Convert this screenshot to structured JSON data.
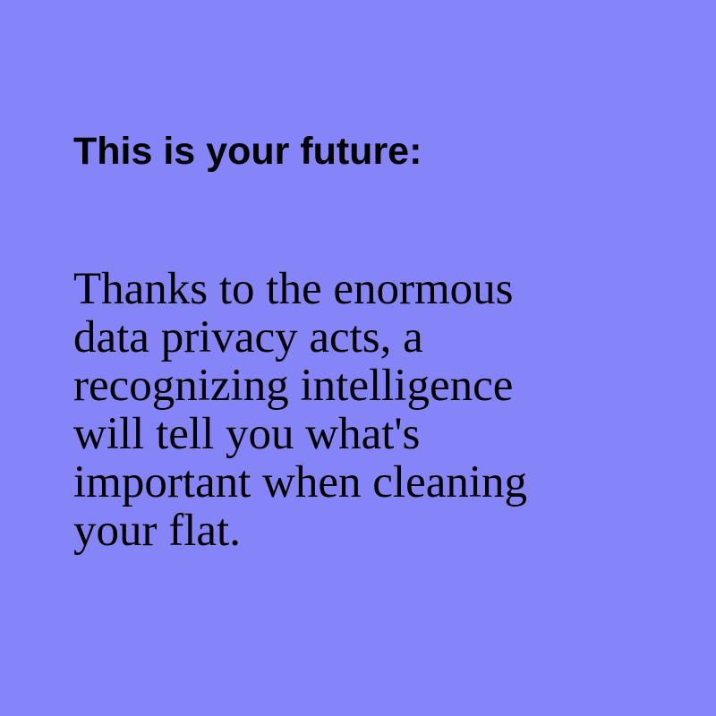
{
  "card": {
    "background_color": "#8585f8",
    "text_color": "#000000",
    "heading": "This is your future:",
    "body_lines": [
      "Thanks to the enormous",
      "data privacy acts, a",
      "recognizing intelligence",
      "will tell you what's",
      "important when cleaning",
      "your flat."
    ]
  }
}
